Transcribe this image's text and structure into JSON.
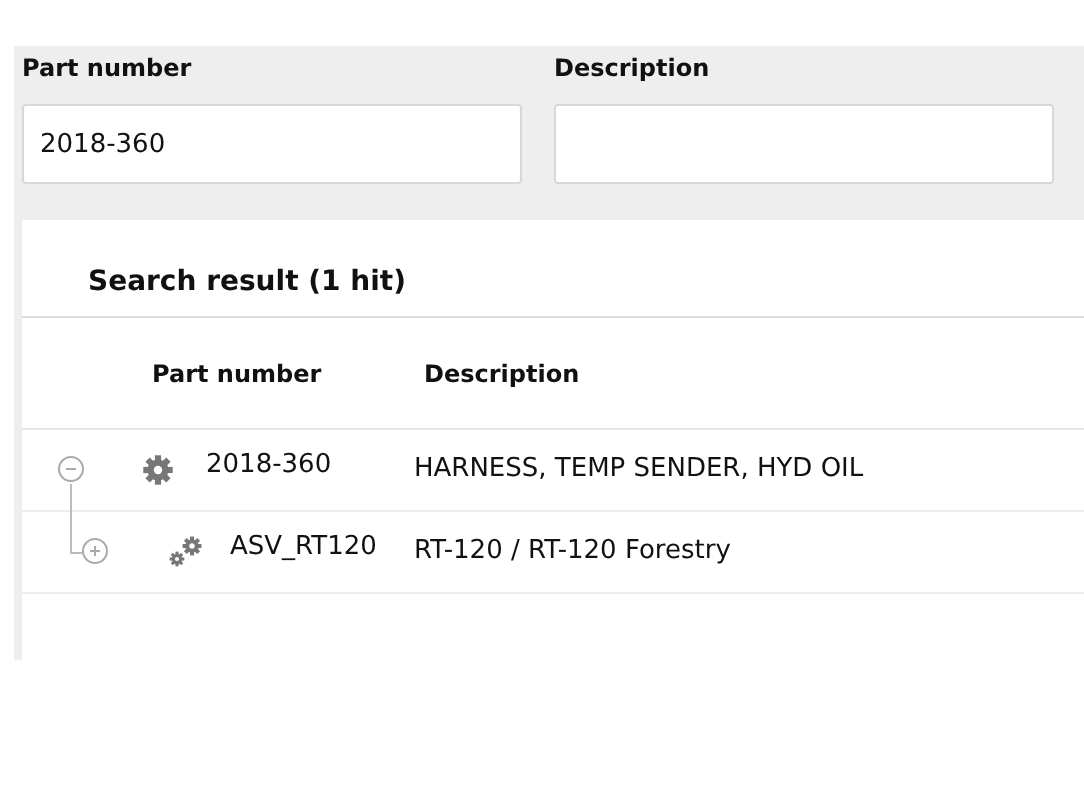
{
  "search_form": {
    "fields": [
      {
        "label": "Part number",
        "value": "2018-360"
      },
      {
        "label": "Description"
      }
    ]
  },
  "results": {
    "title": "Search result (1 hit)",
    "columns": [
      "Part number",
      "Description"
    ],
    "rows": [
      {
        "part_number": "2018-360",
        "description": "HARNESS, TEMP SENDER, HYD OIL",
        "kind": "part",
        "expanded": true,
        "children": [
          {
            "part_number": "ASV_RT120",
            "description": "RT-120 / RT-120 Forestry",
            "kind": "assembly",
            "expanded": false
          }
        ]
      }
    ]
  }
}
